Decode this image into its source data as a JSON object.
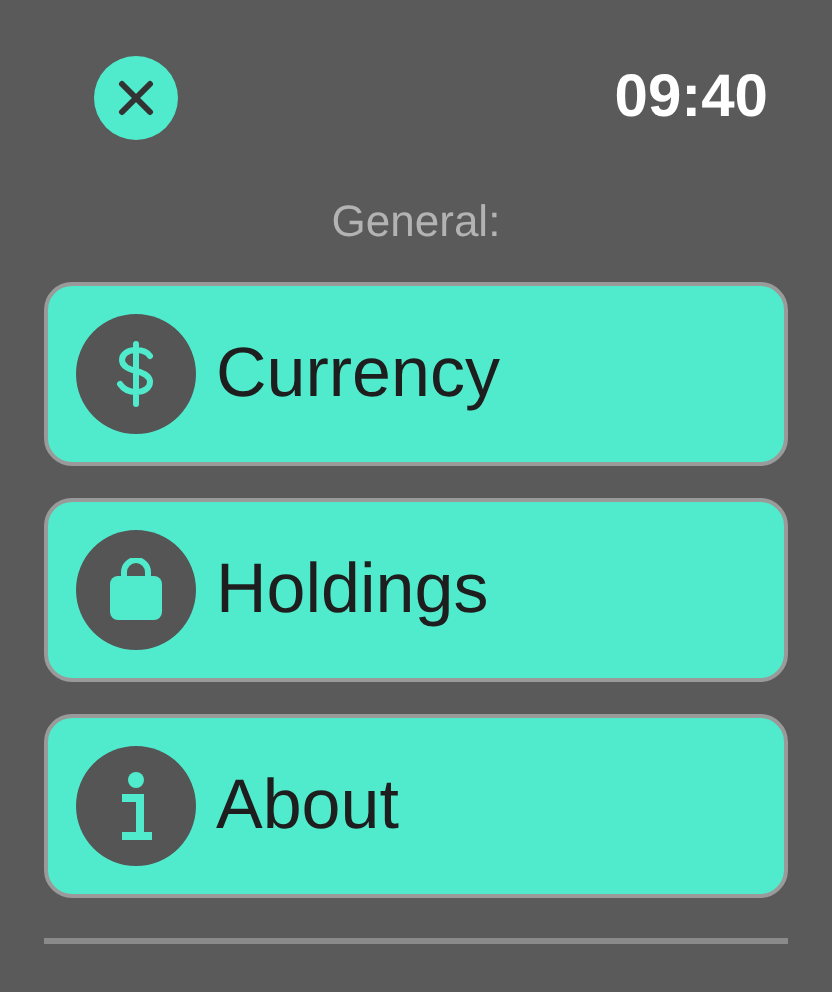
{
  "status_bar": {
    "time": "09:40"
  },
  "section": {
    "title": "General:"
  },
  "items": [
    {
      "label": "Currency",
      "kind": "currency"
    },
    {
      "label": "Holdings",
      "kind": "holdings"
    },
    {
      "label": "About",
      "kind": "about"
    }
  ]
}
